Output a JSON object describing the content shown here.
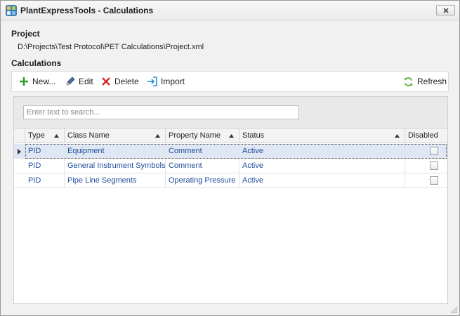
{
  "window": {
    "title": "PlantExpressTools - Calculations",
    "icon": "app-icon",
    "close_icon": "close-icon"
  },
  "project": {
    "heading": "Project",
    "path": "D:\\Projects\\Test Protocol\\PET Calculations\\Project.xml"
  },
  "calculations": {
    "heading": "Calculations"
  },
  "toolbar": {
    "new_label": "New...",
    "edit_label": "Edit",
    "delete_label": "Delete",
    "import_label": "Import",
    "refresh_label": "Refresh",
    "colors": {
      "new": "#2aa12a",
      "delete": "#d42a2a",
      "import": "#2b8fd6",
      "refresh": "#63b33c"
    }
  },
  "search": {
    "placeholder": "Enter text to search...",
    "value": ""
  },
  "grid": {
    "columns": [
      {
        "label": "Type",
        "sort": "asc"
      },
      {
        "label": "Class Name",
        "sort": "asc"
      },
      {
        "label": "Property Name",
        "sort": "asc"
      },
      {
        "label": "Status",
        "sort": "asc"
      },
      {
        "label": "Disabled",
        "sort": ""
      }
    ],
    "rows": [
      {
        "type": "PID",
        "class_name": "Equipment",
        "property_name": "Comment",
        "status": "Active",
        "disabled": false,
        "selected": true
      },
      {
        "type": "PID",
        "class_name": "General Instrument Symbols",
        "property_name": "Comment",
        "status": "Active",
        "disabled": false,
        "selected": false
      },
      {
        "type": "PID",
        "class_name": "Pipe Line Segments",
        "property_name": "Operating Pressure",
        "status": "Active",
        "disabled": false,
        "selected": false
      }
    ]
  }
}
